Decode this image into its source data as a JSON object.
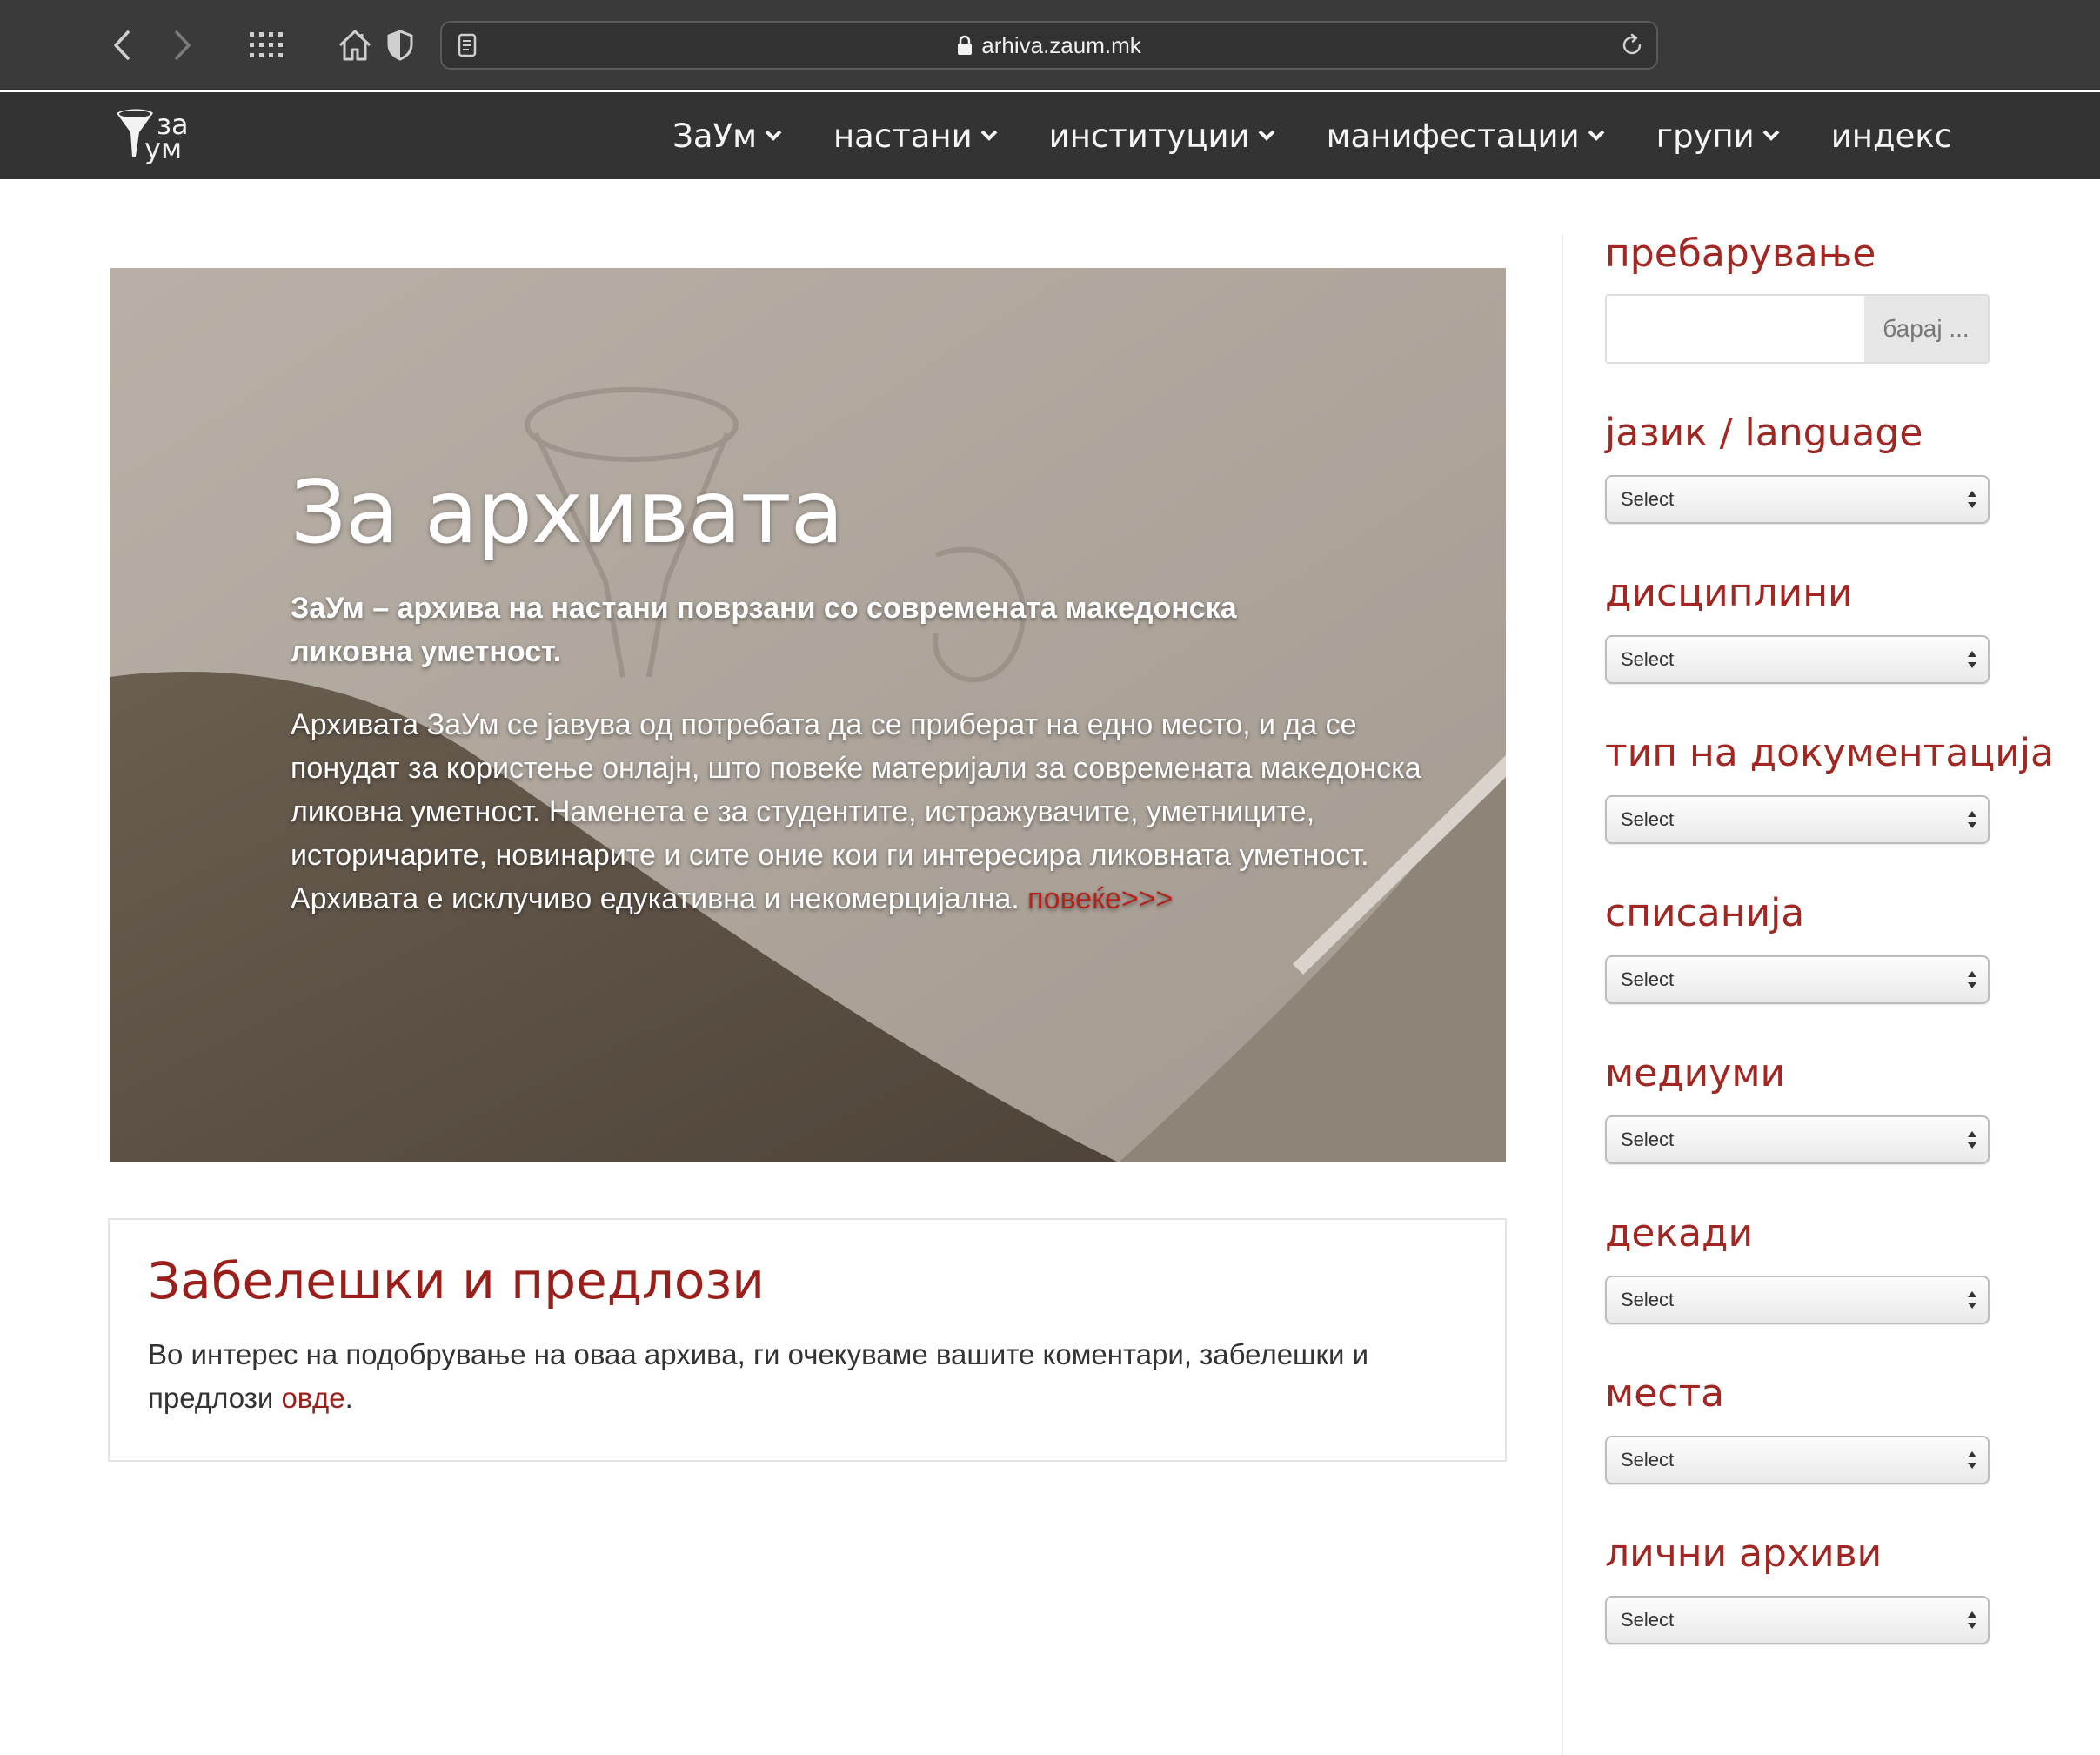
{
  "browser": {
    "url": "arhiva.zaum.mk",
    "icons": [
      "back-icon",
      "forward-icon",
      "grid-icon",
      "home-icon",
      "shield-icon",
      "reader-icon",
      "lock-icon",
      "reload-icon"
    ]
  },
  "nav": {
    "logo": {
      "line1": "за",
      "line2": "ум"
    },
    "items": [
      {
        "label": "ЗаУм",
        "has_dropdown": true
      },
      {
        "label": "настани",
        "has_dropdown": true
      },
      {
        "label": "институции",
        "has_dropdown": true
      },
      {
        "label": "манифестации",
        "has_dropdown": true
      },
      {
        "label": "групи",
        "has_dropdown": true
      },
      {
        "label": "индекс",
        "has_dropdown": false
      }
    ]
  },
  "hero": {
    "title": "За архивата",
    "subtitle": "ЗаУм – архива на настани поврзани со современата македонска ликовна уметност.",
    "body": "Архивата ЗаУм се јавува од потребата да се приберат на едно место, и да се понудат за користење онлајн, што повеќе материјали за современата македонска ликовна уметност. Наменета е за студентите, истражувачите, уметниците, историчарите, новинарите и сите оние кои ги интересира ликовната уметност. Архивата е исклучиво едукативна и некомерцијална.",
    "more_link": "повеќе>>>"
  },
  "notes": {
    "title": "Забелешки и предлози",
    "body": "Во интерес на подобрување на оваа архива, ги очекуваме вашите коментари, забелешки и предлози ",
    "link": "овде",
    "period": "."
  },
  "sidebar": {
    "search": {
      "heading": "пребарување",
      "input_value": "",
      "button": "барај ..."
    },
    "filters": [
      {
        "heading": "јазик / language",
        "selected": "Select"
      },
      {
        "heading": "дисциплини",
        "selected": "Select"
      },
      {
        "heading": "тип на документација",
        "selected": "Select"
      },
      {
        "heading": "списанија",
        "selected": "Select"
      },
      {
        "heading": "медиуми",
        "selected": "Select"
      },
      {
        "heading": "декади",
        "selected": "Select"
      },
      {
        "heading": "места",
        "selected": "Select"
      },
      {
        "heading": "лични архиви",
        "selected": "Select"
      }
    ]
  },
  "colors": {
    "accent": "#9a1f1a",
    "nav_bg": "#333333",
    "browser_bg": "#3a3a3a"
  }
}
